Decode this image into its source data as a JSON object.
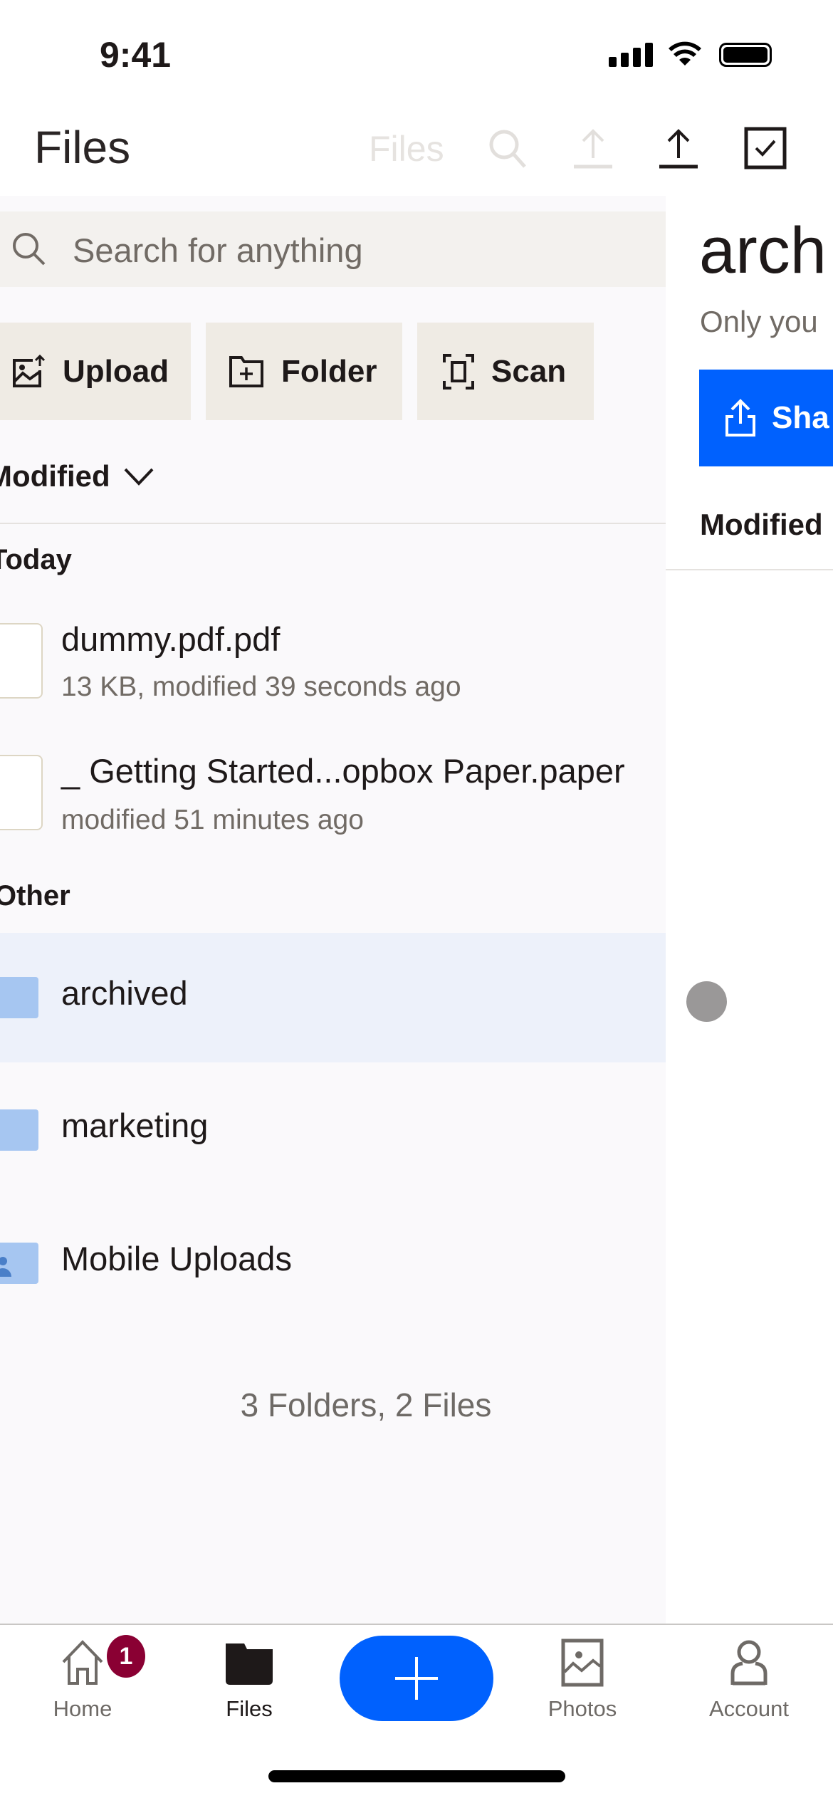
{
  "status_bar": {
    "time": "9:41"
  },
  "header": {
    "title": "Files",
    "faded_title": "Files",
    "icons": [
      "search-icon",
      "upload-icon",
      "upload-icon",
      "select-checkbox-icon"
    ]
  },
  "search": {
    "placeholder": "Search for anything"
  },
  "actions": [
    {
      "label": "Upload",
      "icon": "upload-photo-icon"
    },
    {
      "label": "Folder",
      "icon": "new-folder-icon"
    },
    {
      "label": "Scan",
      "icon": "scan-icon"
    }
  ],
  "sort": {
    "label": "Modified"
  },
  "sections": {
    "today": "Today",
    "other": "Other"
  },
  "files": [
    {
      "name": "dummy.pdf.pdf",
      "meta": "13 KB, modified 39 seconds ago"
    },
    {
      "name": "_ Getting Started...opbox Paper.paper",
      "meta": "modified 51 minutes ago"
    }
  ],
  "folders": [
    {
      "name": "archived",
      "selected": true
    },
    {
      "name": "marketing"
    },
    {
      "name": "Mobile Uploads"
    }
  ],
  "summary": "3 Folders, 2 Files",
  "detail": {
    "title": "arch",
    "subtitle": "Only you",
    "share_label": "Sha",
    "sort_label": "Modified"
  },
  "tabbar": {
    "items": [
      {
        "label": "Home",
        "badge": "1"
      },
      {
        "label": "Files"
      },
      {
        "label": "Photos"
      },
      {
        "label": "Account"
      }
    ]
  },
  "colors": {
    "accent": "#0061fe",
    "badge": "#8a0033",
    "selected_row": "#edf1fa"
  }
}
